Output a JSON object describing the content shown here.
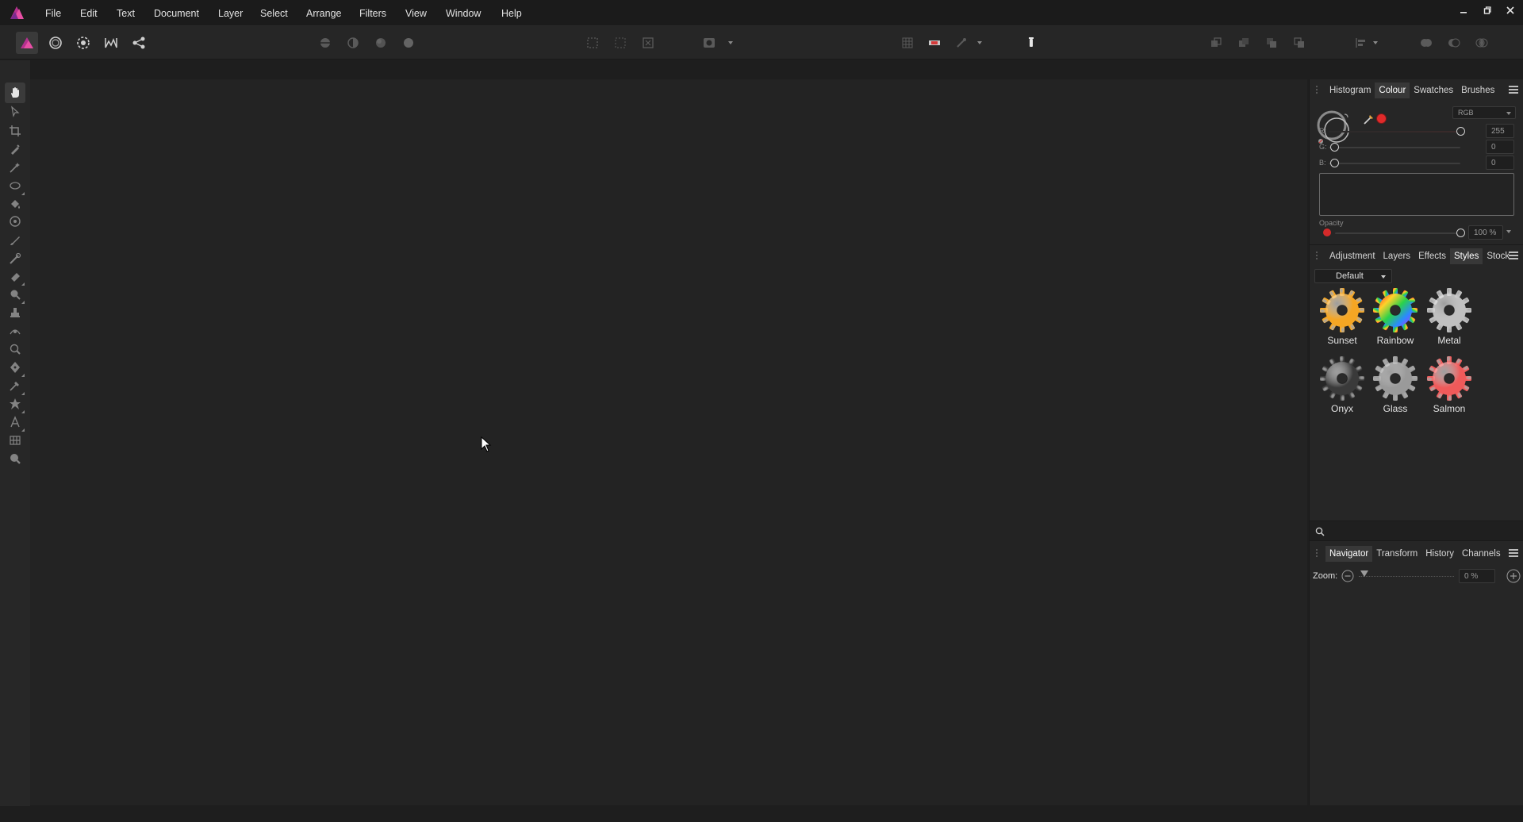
{
  "menubar": {
    "items": [
      "File",
      "Edit",
      "Text",
      "Document",
      "Layer",
      "Select",
      "Arrange",
      "Filters",
      "View",
      "Window",
      "Help"
    ]
  },
  "colours": {
    "brand": "#e83e8c",
    "accent_red": "#e02a2a",
    "background": "#1e1e1e",
    "panel": "#262626"
  },
  "colour_panel": {
    "tabs": [
      "Histogram",
      "Colour",
      "Swatches",
      "Brushes"
    ],
    "active_tab": "Colour",
    "model": "RGB",
    "channels": [
      {
        "label": "R:",
        "value": "255"
      },
      {
        "label": "G:",
        "value": "0"
      },
      {
        "label": "B:",
        "value": "0"
      }
    ],
    "opacity_label": "Opacity",
    "opacity_value": "100 %"
  },
  "styles_panel": {
    "tabs": [
      "Adjustment",
      "Layers",
      "Effects",
      "Styles",
      "Stock"
    ],
    "active_tab": "Styles",
    "category": "Default",
    "styles": [
      {
        "name": "Sunset",
        "color": "#f5a623"
      },
      {
        "name": "Rainbow",
        "color": "rainbow"
      },
      {
        "name": "Metal",
        "color": "#c0c0c0"
      },
      {
        "name": "Onyx",
        "color": "#3a3a3a"
      },
      {
        "name": "Glass",
        "color": "#9a9a9a"
      },
      {
        "name": "Salmon",
        "color": "#ef5a5a"
      }
    ]
  },
  "navigator_panel": {
    "tabs": [
      "Navigator",
      "Transform",
      "History",
      "Channels"
    ],
    "active_tab": "Navigator",
    "zoom_label": "Zoom:",
    "zoom_value": "0 %"
  }
}
